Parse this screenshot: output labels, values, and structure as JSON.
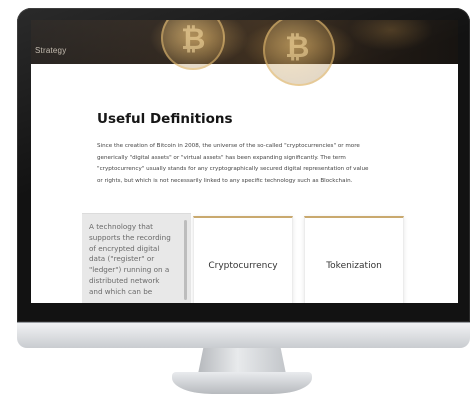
{
  "banner": {
    "label": "Strategy"
  },
  "section": {
    "title": "Useful Definitions",
    "intro_lines": [
      "Since the creation of Bitcoin in 2008, the universe of the so-called \"cryptocurrencies\" or more",
      "generically \"digital assets\" or \"virtual assets\" has been expanding significantly. The term",
      "\"cryptocurrency\" usually stands for any cryptographically secured digital representation of value",
      "or rights, but which is not necessarily linked to any specific technology such as Blockchain."
    ]
  },
  "definition_panel": {
    "lines": [
      "A technology that",
      "supports the recording",
      "of encrypted digital",
      "data (\"register\" or",
      "\"ledger\") running on a",
      "distributed network",
      "and which can be"
    ]
  },
  "cards": [
    {
      "label": "Cryptocurrency"
    },
    {
      "label": "Tokenization"
    }
  ]
}
